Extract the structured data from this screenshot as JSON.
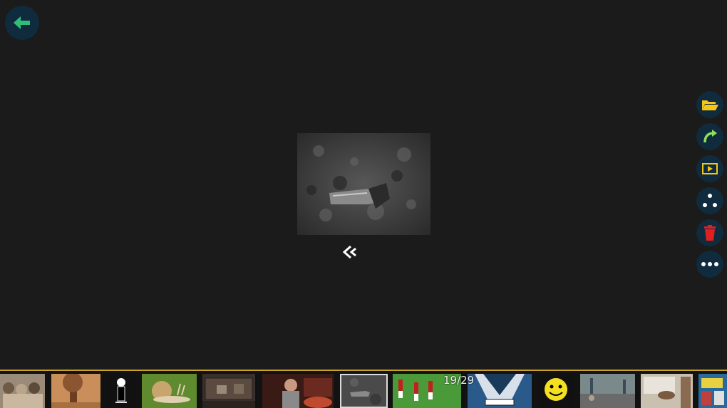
{
  "viewer": {
    "counter": "19/29",
    "icons": {
      "back": "arrow-left-icon",
      "open": "folder-open-icon",
      "rotate": "rotate-right-icon",
      "slideshow": "play-icon",
      "share": "share-icon",
      "delete": "trash-icon",
      "more": "more-icon",
      "nav": "chevron-left-icon"
    },
    "colors": {
      "accent": "#c9a227",
      "back_arrow": "#2fbf7a",
      "folder": "#f5c518",
      "rotate": "#8ee05a",
      "play": "#f5c518",
      "delete": "#e02020",
      "button_bg": "#0f2b3d"
    }
  },
  "filmstrip": {
    "selected_index": 6,
    "thumbnails": [
      "kittens",
      "tree",
      "cartoon-figure",
      "snail",
      "cat-in-room",
      "woman-in-bedroom",
      "creature-on-ground",
      "soccer-players",
      "anime-character",
      "smiley-face",
      "street-scene",
      "dog-indoors",
      "comic"
    ]
  }
}
